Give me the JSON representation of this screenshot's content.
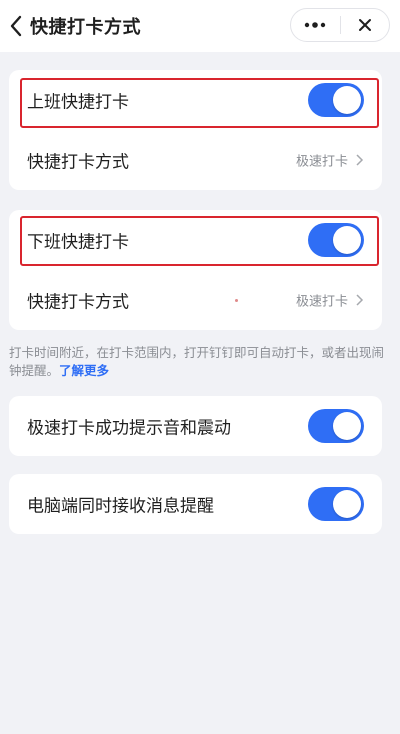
{
  "header": {
    "title": "快捷打卡方式",
    "back_icon": "chevron-left-icon",
    "more_icon": "more-dots-icon",
    "close_icon": "close-icon"
  },
  "sections": [
    {
      "rows": [
        {
          "label": "上班快捷打卡",
          "type": "toggle",
          "on": true
        },
        {
          "label": "快捷打卡方式",
          "type": "link",
          "value": "极速打卡"
        }
      ]
    },
    {
      "rows": [
        {
          "label": "下班快捷打卡",
          "type": "toggle",
          "on": true
        },
        {
          "label": "快捷打卡方式",
          "type": "link",
          "value": "极速打卡"
        }
      ]
    }
  ],
  "note": {
    "text": "打卡时间附近，在打卡范围内，打开钉钉即可自动打卡，或者出现闹钟提醒。",
    "link": "了解更多"
  },
  "settings": [
    {
      "label": "极速打卡成功提示音和震动",
      "type": "toggle",
      "on": true
    },
    {
      "label": "电脑端同时接收消息提醒",
      "type": "toggle",
      "on": true
    }
  ],
  "colors": {
    "accent": "#2f6ef5",
    "highlight": "#d9252e",
    "background": "#f1f2f6"
  }
}
